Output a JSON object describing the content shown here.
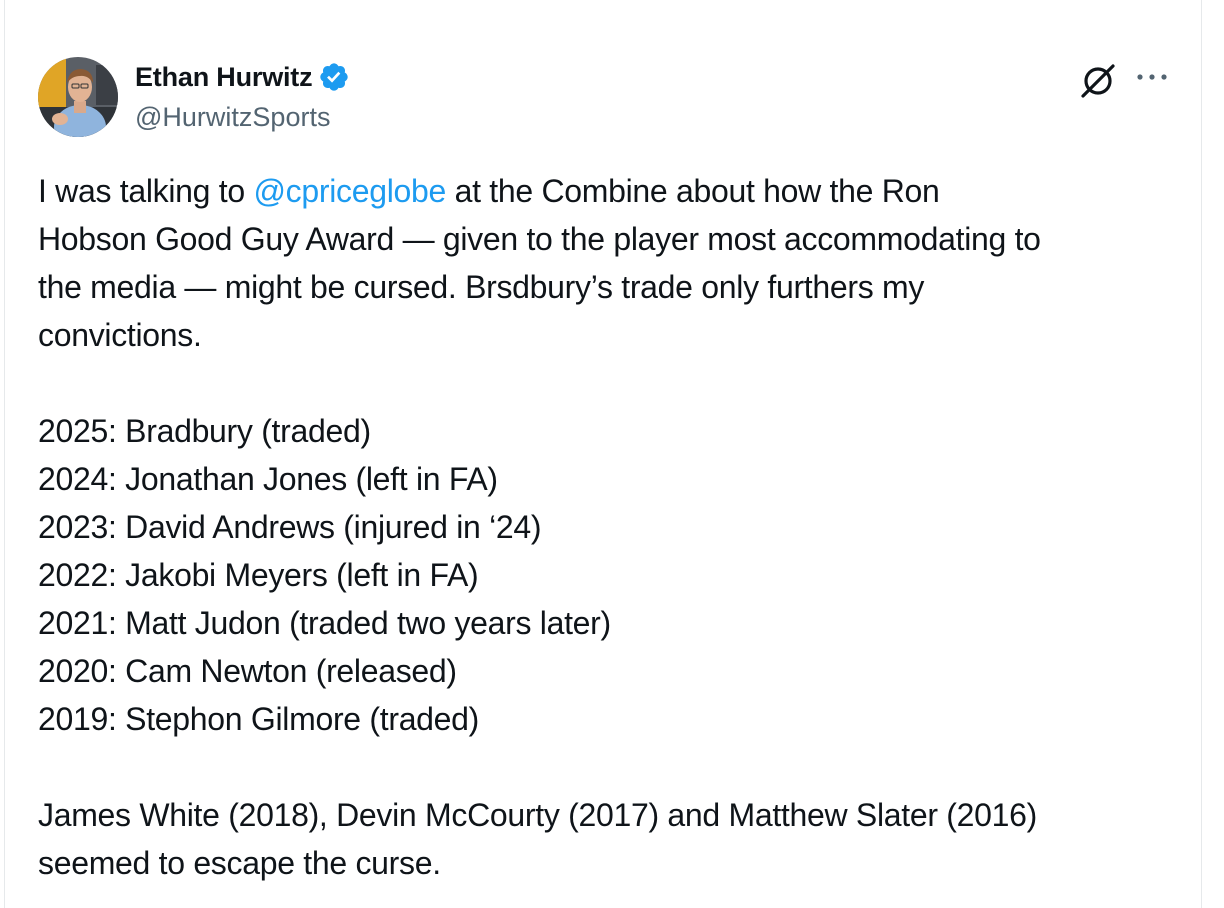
{
  "author": {
    "name": "Ethan Hurwitz",
    "handle": "@HurwitzSports",
    "verified": true,
    "verified_color": "#1d9bf0"
  },
  "icons": {
    "grok": "grok-icon",
    "more": "more-options-icon",
    "verified": "verified-badge-icon"
  },
  "tweet": {
    "intro_lines": [
      {
        "before": "I was talking to ",
        "mention": "@cpriceglobe",
        "after": " at the Combine about how the Ron"
      },
      {
        "text": "Hobson Good Guy Award — given to the player most accommodating to"
      },
      {
        "text": "the media — might be cursed. Brsdbury’s trade only furthers my"
      },
      {
        "text": "convictions."
      }
    ],
    "list_lines": [
      "2025: Bradbury (traded)",
      "2024: Jonathan Jones (left in FA)",
      "2023: David Andrews (injured in ‘24)",
      "2022: Jakobi Meyers (left in FA)",
      "2021: Matt Judon (traded two years later)",
      "2020: Cam Newton (released)",
      "2019: Stephon Gilmore (traded)"
    ],
    "closing_lines": [
      "James White (2018), Devin McCourty (2017) and Matthew Slater (2016)",
      "seemed to escape the curse."
    ]
  },
  "colors": {
    "text": "#0f1419",
    "secondary": "#536471",
    "link": "#1d9bf0"
  }
}
